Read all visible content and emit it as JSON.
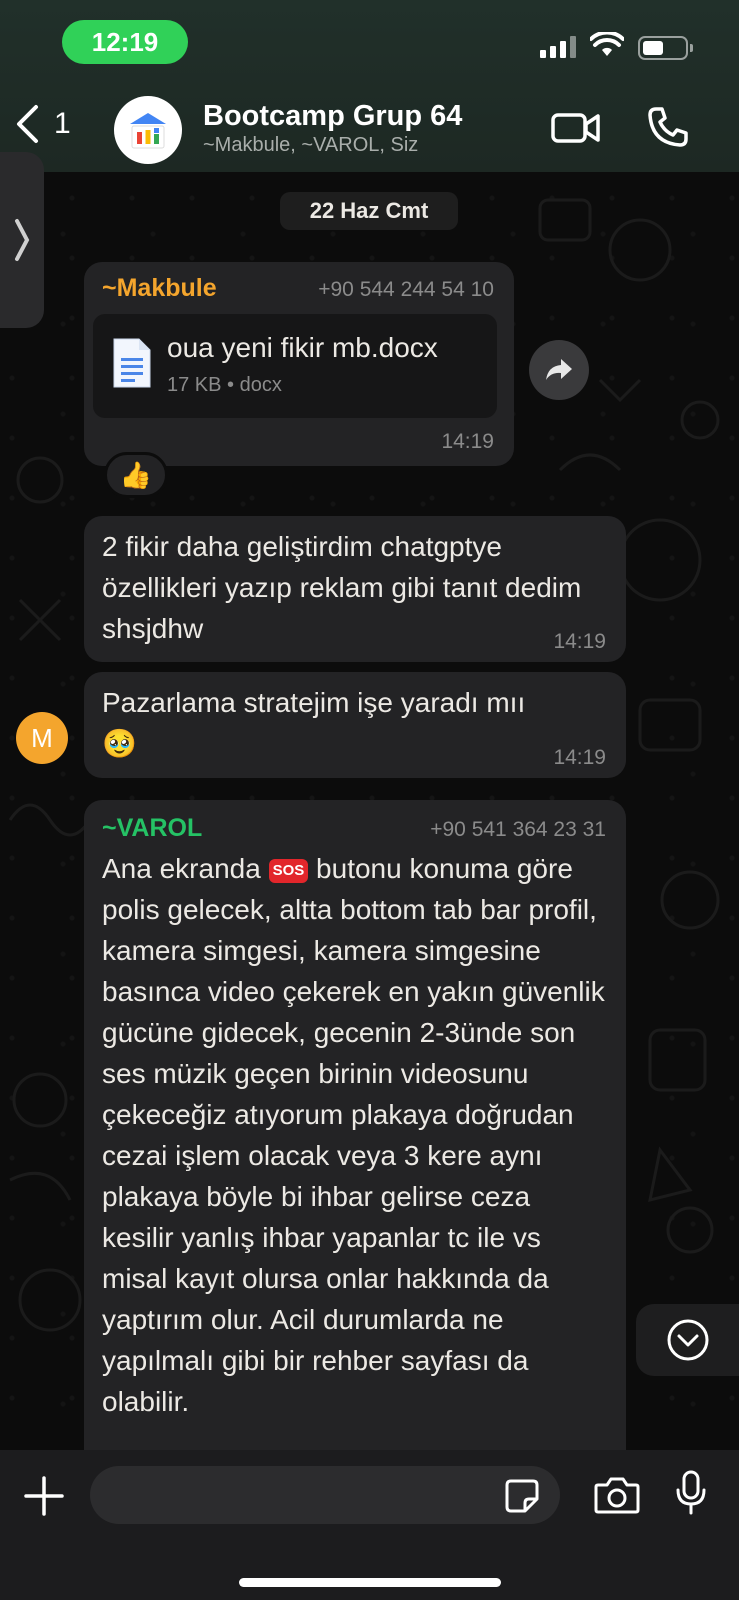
{
  "status_bar": {
    "time": "12:19"
  },
  "header": {
    "back_count": "1",
    "title": "Bootcamp Grup 64",
    "members": "~Makbule, ~VAROL, Siz"
  },
  "date_separator": "22 Haz Cmt",
  "messages": {
    "doc": {
      "sender": "~Makbule",
      "sender_color": "#f4a52d",
      "phone": "+90 544 244 54 10",
      "file_name": "oua yeni fikir mb.docx",
      "file_meta": "17 KB • docx",
      "time": "14:19",
      "reaction": "👍"
    },
    "m2": {
      "text": "2 fikir daha geliştirdim chatgptye özellikleri yazıp reklam gibi tanıt dedim shsjdhw",
      "time": "14:19"
    },
    "m3": {
      "text": "Pazarlama stratejim işe yaradı mıı",
      "emoji": "🥹",
      "time": "14:19",
      "avatar_letter": "M"
    },
    "m4": {
      "sender": "~VAROL",
      "sender_color": "#25c265",
      "phone": "+90 541 364 23 31",
      "text_before": "Ana ekranda",
      "sos": "SOS",
      "text_after": "butonu konuma göre polis gelecek, altta bottom tab bar profil, kamera simgesi, kamera simgesine basınca video çekerek en yakın güvenlik gücüne gidecek, gecenin 2-3ünde son ses müzik geçen birinin videosunu çekeceğiz atıyorum plakaya doğrudan cezai işlem olacak veya 3 kere aynı plakaya böyle bi ihbar gelirse ceza kesilir yanlış ihbar yapanlar tc ile vs misal kayıt olursa onlar hakkında da yaptırım olur. Acil durumlarda ne yapılmalı gibi bir rehber sayfası da olabilir."
    }
  },
  "composer": {
    "placeholder": ""
  }
}
